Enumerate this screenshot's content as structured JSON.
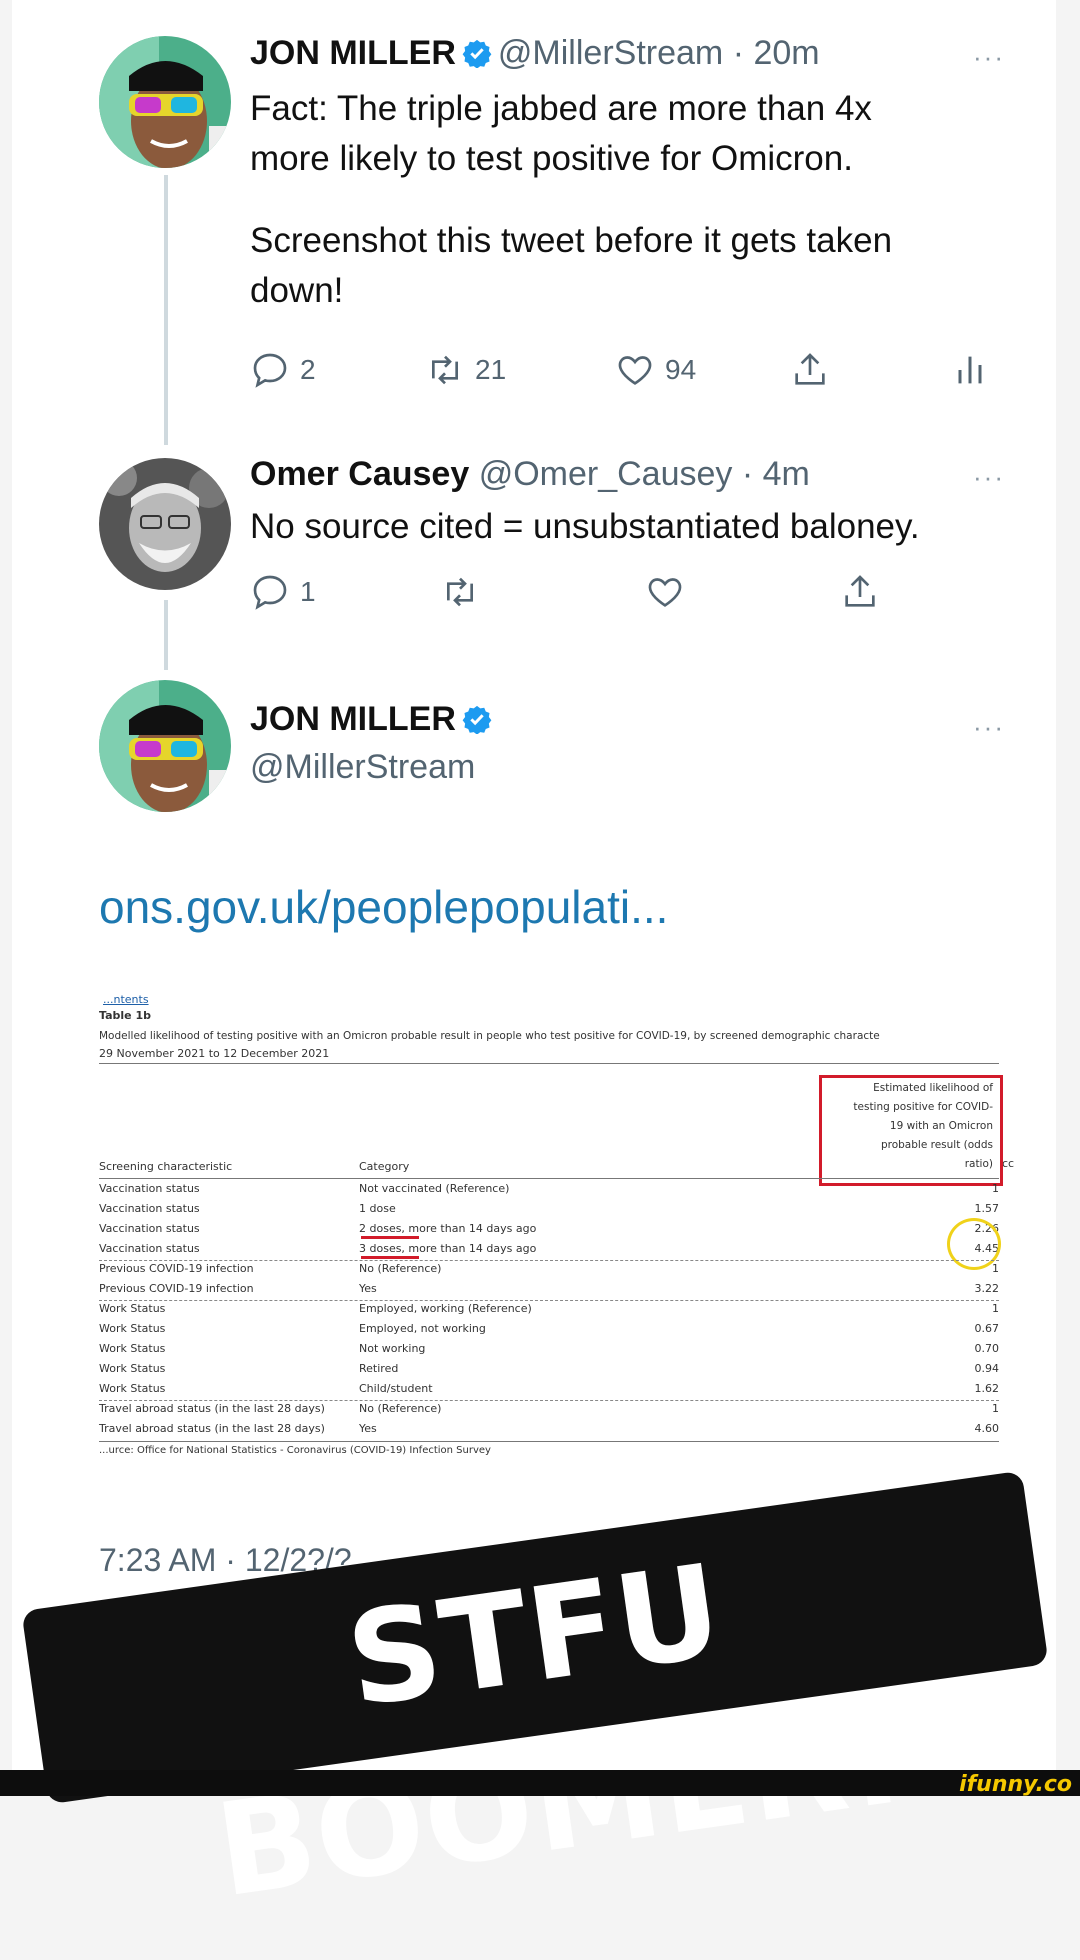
{
  "tweets": [
    {
      "name": "JON MILLER",
      "handle": "@MillerStream",
      "time": "· 20m",
      "more": "···",
      "text_line1": "Fact: The triple jabbed are more than 4x",
      "text_line2": "more likely to test positive for Omicron.",
      "text_line3": "Screenshot this tweet before it gets taken",
      "text_line4": "down!",
      "replies": "2",
      "retweets": "21",
      "likes": "94"
    },
    {
      "name": "Omer Causey",
      "handle": "@Omer_Causey",
      "time": "· 4m",
      "more": "···",
      "text_line1": "No source cited = unsubstantiated baloney.",
      "replies": "1"
    },
    {
      "name": "JON MILLER",
      "handle": "@MillerStream",
      "more": "···",
      "link": "ons.gov.uk/peoplepopulati...",
      "timestamp": "7:23 AM · 12/2?/?"
    }
  ],
  "ons_table": {
    "contents": "...ntents",
    "table_id": "Table 1b",
    "caption": "Modelled likelihood of testing positive with an Omicron probable result in people who test positive for COVID-19, by screened demographic characte",
    "date_range": "29 November 2021 to 12 December 2021",
    "col3_header": [
      "Estimated likelihood of",
      "testing positive for COVID-",
      "19 with an Omicron",
      "probable result (odds",
      "ratio)"
    ],
    "col3_extra": "cc",
    "col1_header": "Screening characteristic",
    "col2_header": "Category",
    "rows": [
      {
        "c1": "Vaccination status",
        "c2": "Not vaccinated (Reference)",
        "c3": "1"
      },
      {
        "c1": "Vaccination status",
        "c2": "1 dose",
        "c3": "1.57"
      },
      {
        "c1": "Vaccination status",
        "c2": "2 doses, more than 14 days ago",
        "c3": "2.26"
      },
      {
        "c1": "Vaccination status",
        "c2": "3 doses, more than 14 days ago",
        "c3": "4.45"
      },
      {
        "c1": "Previous COVID-19 infection",
        "c2": "No (Reference)",
        "c3": "1"
      },
      {
        "c1": "Previous COVID-19 infection",
        "c2": "Yes",
        "c3": "3.22"
      },
      {
        "c1": "Work Status",
        "c2": "Employed, working (Reference)",
        "c3": "1"
      },
      {
        "c1": "Work Status",
        "c2": "Employed, not working",
        "c3": "0.67"
      },
      {
        "c1": "Work Status",
        "c2": "Not working",
        "c3": "0.70"
      },
      {
        "c1": "Work Status",
        "c2": "Retired",
        "c3": "0.94"
      },
      {
        "c1": "Work Status",
        "c2": "Child/student",
        "c3": "1.62"
      },
      {
        "c1": "Travel abroad status (in the last 28 days)",
        "c2": "No (Reference)",
        "c3": "1"
      },
      {
        "c1": "Travel abroad status (in the last 28 days)",
        "c2": "Yes",
        "c3": "4.60"
      }
    ],
    "source": "...urce: Office for National Statistics - Coronavirus (COVID-19) Infection Survey"
  },
  "banner_text": "STFU BOOMER.",
  "watermark": "ifunny.co",
  "colors": {
    "verified_blue": "#1d9bf0",
    "link_blue": "#1d78b0",
    "highlight_red": "#d21b2a",
    "highlight_yellow": "#f0d21a"
  }
}
